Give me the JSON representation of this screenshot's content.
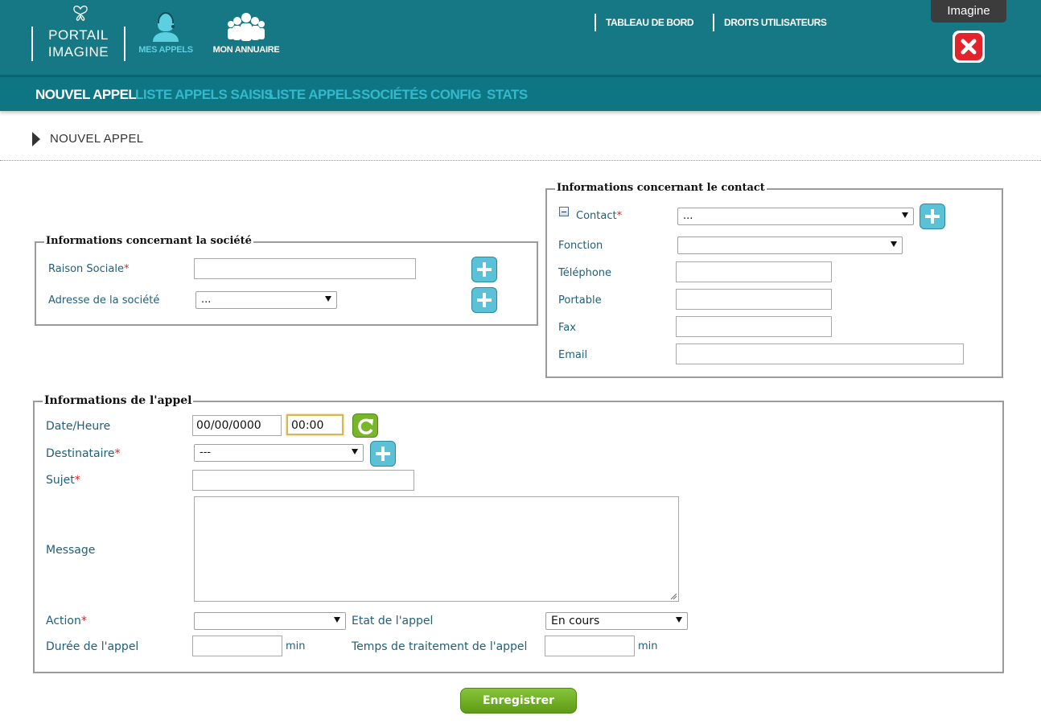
{
  "header": {
    "logo_line1": "PORTAIL",
    "logo_line2": "IMAGINE",
    "mes_appels_label": "MES APPELS",
    "mon_annuaire_label": "MON ANNUAIRE",
    "tableau_de_bord_label": "TABLEAU DE BORD",
    "droits_utilisateurs_label": "DROITS UTILISATEURS",
    "user_name": "Imagine",
    "logo_icon": "butterfly-icon",
    "mes_appels_icon": "headset-user-icon",
    "mon_annuaire_icon": "group-icon",
    "close_icon": "close-icon"
  },
  "subnav": {
    "items": [
      {
        "label": "NOUVEL APPEL",
        "active": true
      },
      {
        "label": "LISTE APPELS SAISIS",
        "active": false
      },
      {
        "label": "LISTE APPELS",
        "active": false
      },
      {
        "label": "SOCIÉTÉS",
        "active": false
      },
      {
        "label": "CONFIG",
        "active": false
      },
      {
        "label": "STATS",
        "active": false
      }
    ]
  },
  "breadcrumb": {
    "label": "NOUVEL APPEL"
  },
  "societe": {
    "legend": "Informations concernant la société",
    "raison_sociale_label": "Raison Sociale",
    "raison_sociale_value": "",
    "adresse_label": "Adresse de la société",
    "adresse_value": "..."
  },
  "contact": {
    "legend": "Informations concernant le contact",
    "contact_label": "Contact",
    "contact_value": "...",
    "fonction_label": "Fonction",
    "fonction_value": "",
    "telephone_label": "Téléphone",
    "telephone_value": "",
    "portable_label": "Portable",
    "portable_value": "",
    "fax_label": "Fax",
    "fax_value": "",
    "email_label": "Email",
    "email_value": ""
  },
  "appel": {
    "legend": "Informations de l'appel",
    "date_heure_label": "Date/Heure",
    "date_value": "00/00/0000",
    "time_value": "00:00",
    "destinataire_label": "Destinataire",
    "destinataire_value": "---",
    "sujet_label": "Sujet",
    "sujet_value": "",
    "message_label": "Message",
    "message_value": "",
    "action_label": "Action",
    "action_value": "",
    "etat_label": "Etat de l'appel",
    "etat_value": "En cours",
    "duree_label": "Durée de l'appel",
    "duree_value": "",
    "duree_unit": "min",
    "temps_label": "Temps de traitement de l'appel",
    "temps_value": "",
    "temps_unit": "min"
  },
  "required_mark": "*",
  "save_label": "Enregistrer",
  "colors": {
    "header_bg": "#167785",
    "subnav_bg": "#0e7683",
    "active_nav": "#ffffff",
    "inactive_nav": "#35b8cb",
    "label_text": "#1f5f7a",
    "required": "#e02020",
    "plus_button": "#5bc1d6",
    "save_button": "#6ea826",
    "close_button": "#e2232b"
  }
}
